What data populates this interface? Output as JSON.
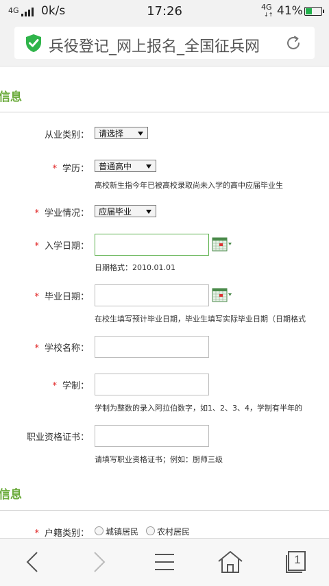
{
  "status_bar": {
    "signal_label": "4G",
    "speed": "0k/s",
    "time": "17:26",
    "signal_label_2": "4G",
    "battery_percent": "41%"
  },
  "browser": {
    "page_title": "兵役登记_网上报名_全国征兵网"
  },
  "sections": {
    "first_title": "信息",
    "second_title": "信息"
  },
  "form": {
    "occupation": {
      "label": "从业类别：",
      "value": "请选择"
    },
    "education": {
      "label": "学历：",
      "value": "普通高中",
      "hint": "高校新生指今年已被高校录取尚未入学的高中应届毕业生"
    },
    "study_status": {
      "label": "学业情况：",
      "value": "应届毕业"
    },
    "enroll_date": {
      "label": "入学日期：",
      "hint": "日期格式：2010.01.01"
    },
    "grad_date": {
      "label": "毕业日期：",
      "hint": "在校生填写预计毕业日期，毕业生填写实际毕业日期（日期格式"
    },
    "school_name": {
      "label": "学校名称："
    },
    "duration": {
      "label": "学制：",
      "hint": "学制为整数的录入阿拉伯数字，如1、2、3、4，学制有半年的"
    },
    "certificate": {
      "label": "职业资格证书：",
      "hint": "请填写职业资格证书；例如：厨师三级"
    },
    "household": {
      "label": "户籍类别：",
      "option1": "城镇居民",
      "option2": "农村居民"
    }
  },
  "required_mark": "*",
  "colors": {
    "accent_green": "#6aaa3a",
    "required_red": "#e02020"
  },
  "icons": [
    "shield-check-icon",
    "reload-icon",
    "calendar-icon",
    "back-icon",
    "forward-icon",
    "menu-icon",
    "home-icon",
    "tabs-icon"
  ],
  "nav": {
    "tab_count": "1"
  }
}
